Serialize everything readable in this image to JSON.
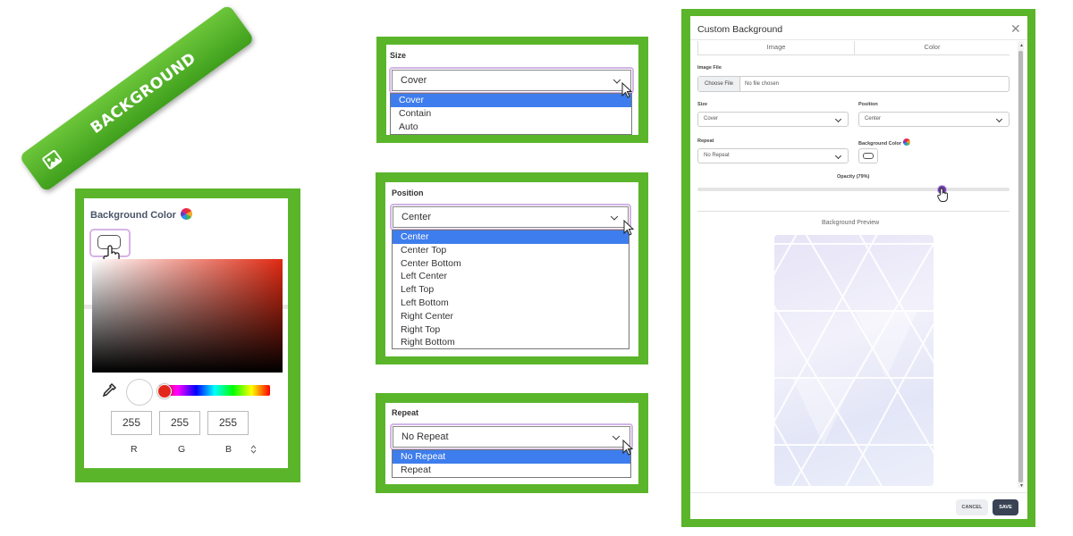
{
  "ribbon": {
    "label": "BACKGROUND",
    "icon": "image-icon"
  },
  "size_panel": {
    "label": "Size",
    "selected": "Cover",
    "options": [
      "Cover",
      "Contain",
      "Auto"
    ]
  },
  "position_panel": {
    "label": "Position",
    "selected": "Center",
    "options": [
      "Center",
      "Center Top",
      "Center Bottom",
      "Left Center",
      "Left Top",
      "Left Bottom",
      "Right Center",
      "Right Top",
      "Right Bottom"
    ]
  },
  "repeat_panel": {
    "label": "Repeat",
    "selected": "No Repeat",
    "options": [
      "No Repeat",
      "Repeat"
    ]
  },
  "color_picker": {
    "label": "Background Color",
    "hue_color": "#e02a12",
    "r": "255",
    "g": "255",
    "b": "255",
    "r_label": "R",
    "g_label": "G",
    "b_label": "B"
  },
  "modal": {
    "title": "Custom Background",
    "tabs": [
      "Image",
      "Color"
    ],
    "image_file_label": "Image File",
    "choose_file": "Choose File",
    "no_file": "No file chosen",
    "size_label": "Size",
    "size_value": "Cover",
    "position_label": "Position",
    "position_value": "Center",
    "repeat_label": "Repeat",
    "repeat_value": "No Repeat",
    "bg_color_label": "Background Color",
    "opacity_label": "Opacity (79%)",
    "opacity_value": 0.79,
    "preview_label": "Background Preview",
    "cancel": "CANCEL",
    "save": "SAVE"
  },
  "colors": {
    "frame_green": "#5ab52a",
    "select_blue": "#3e7ded",
    "save_bg": "#3a4354",
    "focus_purple": "#d1b4e6"
  }
}
